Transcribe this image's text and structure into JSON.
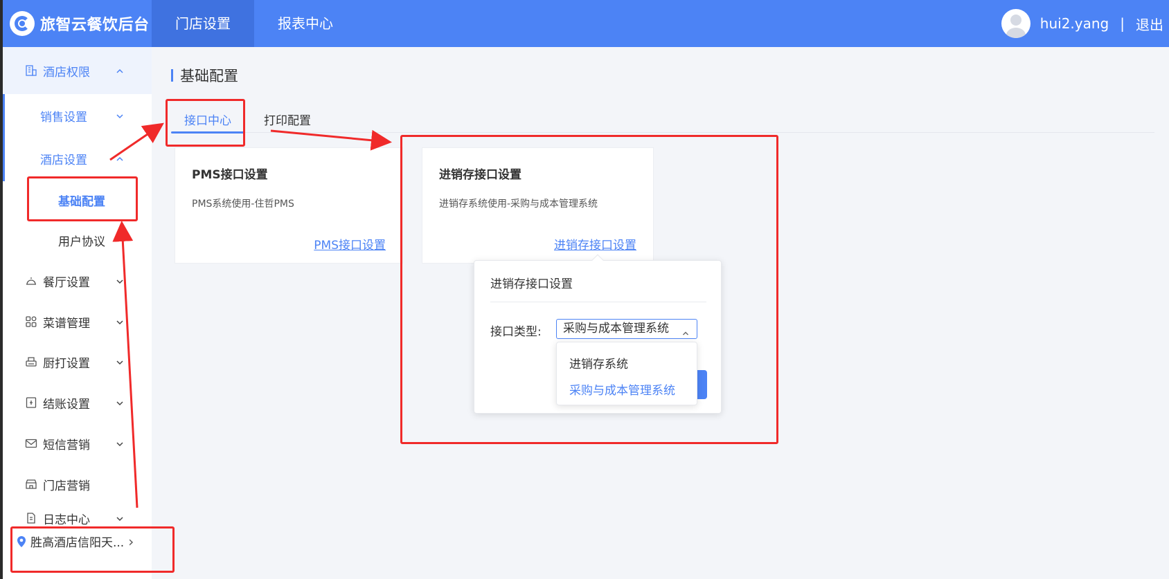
{
  "header": {
    "brand_title": "旅智云餐饮后台",
    "nav": [
      "门店设置",
      "报表中心"
    ],
    "username": "hui2.yang",
    "separator": "|",
    "logout": "退出"
  },
  "sidebar": {
    "hotel_permissions": "酒店权限",
    "sales_settings": "销售设置",
    "hotel_settings": "酒店设置",
    "basic_config": "基础配置",
    "user_agreement": "用户协议",
    "restaurant_settings": "餐厅设置",
    "menu_management": "菜谱管理",
    "kitchen_print_settings": "厨打设置",
    "checkout_settings": "结账设置",
    "sms_marketing": "短信营销",
    "store_marketing": "门店营销",
    "log_center": "日志中心",
    "store_name": "胜高酒店信阳天...",
    "store_chevron": "›"
  },
  "main": {
    "page_title": "基础配置",
    "tabs": [
      "接口中心",
      "打印配置"
    ],
    "cards": [
      {
        "title": "PMS接口设置",
        "desc": "PMS系统使用-住哲PMS",
        "link": "PMS接口设置"
      },
      {
        "title": "进销存接口设置",
        "desc": "进销存系统使用-采购与成本管理系统",
        "link": "进销存接口设置"
      }
    ]
  },
  "popover": {
    "title": "进销存接口设置",
    "field_label": "接口类型:",
    "selected_value": "采购与成本管理系统",
    "options": [
      "进销存系统",
      "采购与成本管理系统"
    ]
  },
  "colors": {
    "primary": "#4c83f5",
    "header_active": "#3f72e0",
    "annotation_red": "#f02a2a",
    "main_bg": "#f3f5f9"
  }
}
